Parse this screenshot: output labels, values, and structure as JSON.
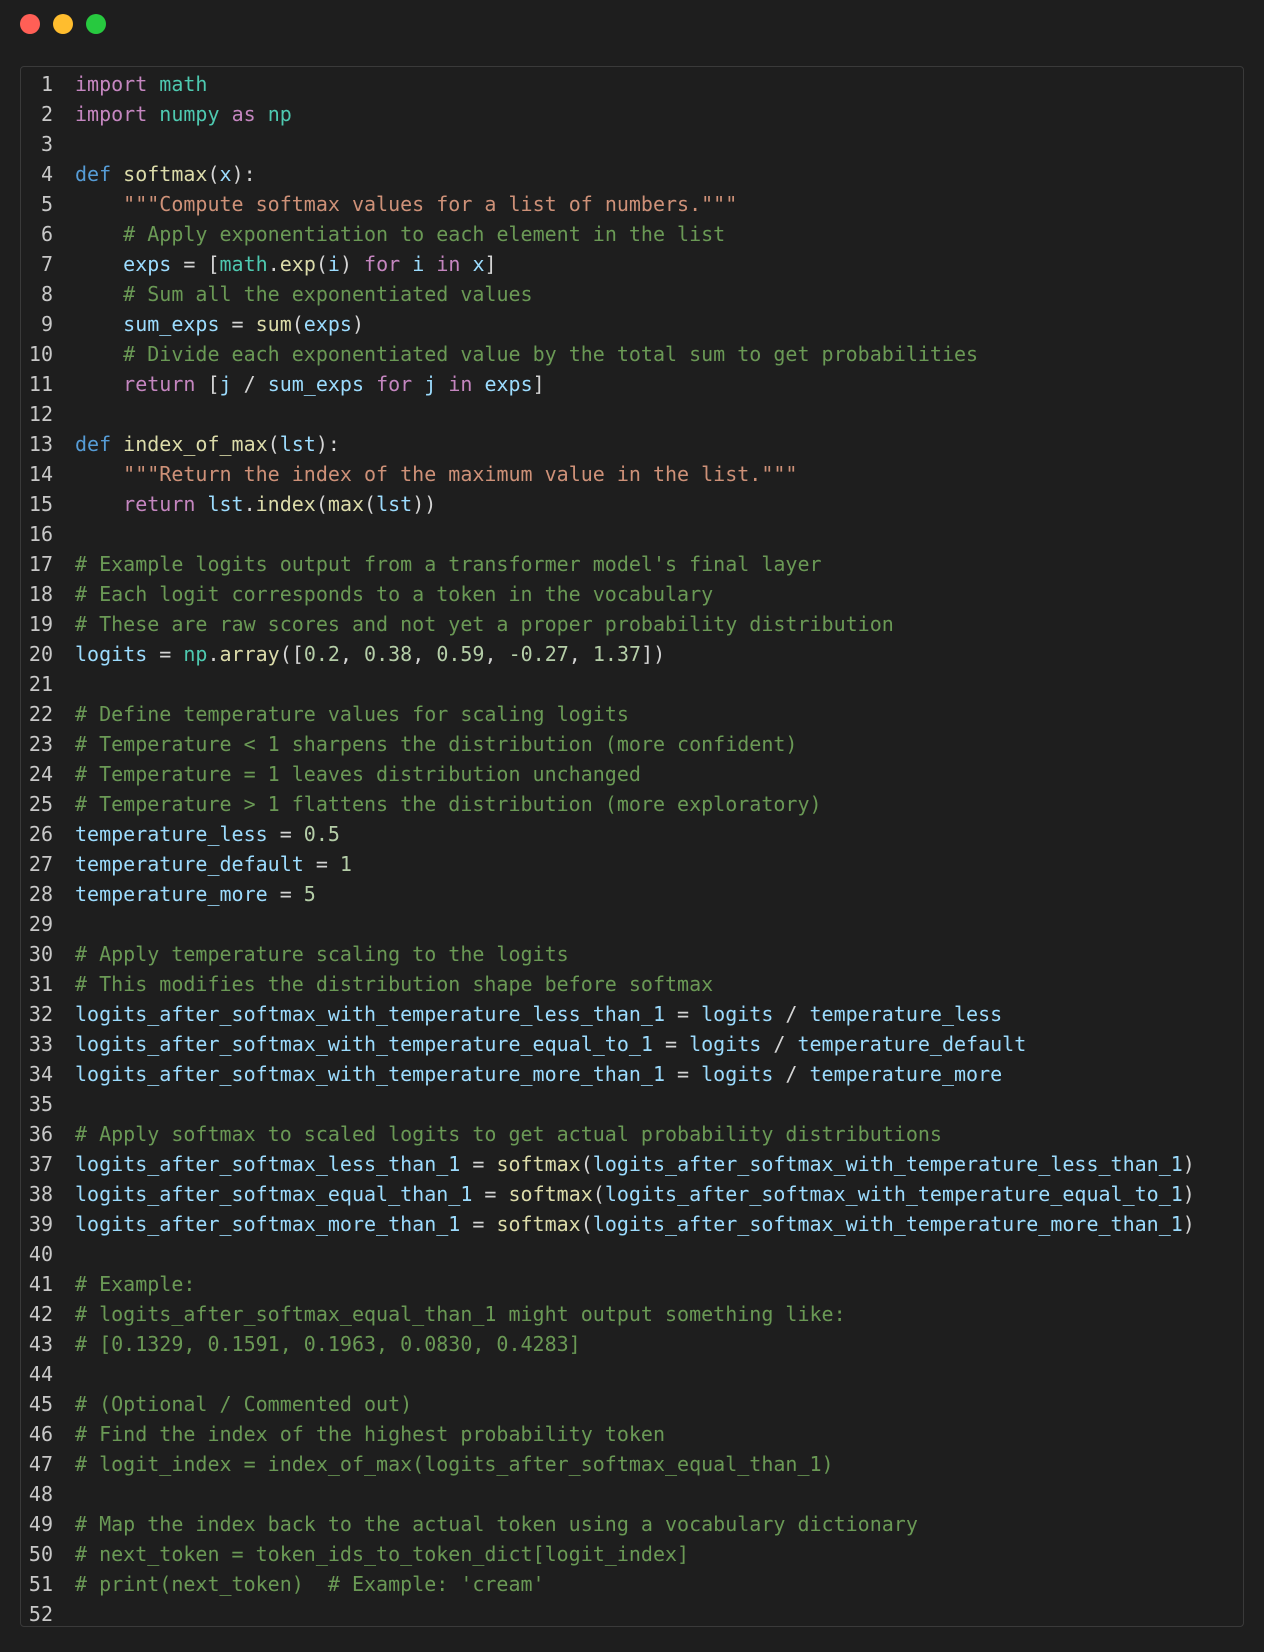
{
  "window": {
    "controls": [
      {
        "name": "close-button",
        "color": "#ff5f56"
      },
      {
        "name": "minimize-button",
        "color": "#ffbd2e"
      },
      {
        "name": "maximize-button",
        "color": "#27c93f"
      }
    ]
  },
  "theme": {
    "background": "#1e1e1e",
    "colors": {
      "plain": "#d4d4d4",
      "kw": "#c586c0",
      "def": "#569cd6",
      "mod": "#4ec9b0",
      "fn": "#dcdcaa",
      "var": "#9cdcfe",
      "str": "#ce9178",
      "cmt": "#6a9955",
      "num": "#b5cea8"
    }
  },
  "editor": {
    "lines": [
      {
        "n": "1",
        "tokens": [
          [
            "kw",
            "import"
          ],
          [
            "plain",
            " "
          ],
          [
            "mod",
            "math"
          ]
        ]
      },
      {
        "n": "2",
        "tokens": [
          [
            "kw",
            "import"
          ],
          [
            "plain",
            " "
          ],
          [
            "mod",
            "numpy"
          ],
          [
            "plain",
            " "
          ],
          [
            "kw",
            "as"
          ],
          [
            "plain",
            " "
          ],
          [
            "mod",
            "np"
          ]
        ]
      },
      {
        "n": "3",
        "tokens": []
      },
      {
        "n": "4",
        "tokens": [
          [
            "def",
            "def"
          ],
          [
            "plain",
            " "
          ],
          [
            "fn",
            "softmax"
          ],
          [
            "plain",
            "("
          ],
          [
            "var",
            "x"
          ],
          [
            "plain",
            "):"
          ]
        ]
      },
      {
        "n": "5",
        "tokens": [
          [
            "plain",
            "    "
          ],
          [
            "str",
            "\"\"\"Compute softmax values for a list of numbers.\"\"\""
          ]
        ]
      },
      {
        "n": "6",
        "tokens": [
          [
            "plain",
            "    "
          ],
          [
            "cmt",
            "# Apply exponentiation to each element in the list"
          ]
        ]
      },
      {
        "n": "7",
        "tokens": [
          [
            "plain",
            "    "
          ],
          [
            "var",
            "exps"
          ],
          [
            "plain",
            " = ["
          ],
          [
            "mod",
            "math"
          ],
          [
            "plain",
            "."
          ],
          [
            "fn",
            "exp"
          ],
          [
            "plain",
            "("
          ],
          [
            "var",
            "i"
          ],
          [
            "plain",
            ") "
          ],
          [
            "kw",
            "for"
          ],
          [
            "plain",
            " "
          ],
          [
            "var",
            "i"
          ],
          [
            "plain",
            " "
          ],
          [
            "kw",
            "in"
          ],
          [
            "plain",
            " "
          ],
          [
            "var",
            "x"
          ],
          [
            "plain",
            "]"
          ]
        ]
      },
      {
        "n": "8",
        "tokens": [
          [
            "plain",
            "    "
          ],
          [
            "cmt",
            "# Sum all the exponentiated values"
          ]
        ]
      },
      {
        "n": "9",
        "tokens": [
          [
            "plain",
            "    "
          ],
          [
            "var",
            "sum_exps"
          ],
          [
            "plain",
            " = "
          ],
          [
            "fn",
            "sum"
          ],
          [
            "plain",
            "("
          ],
          [
            "var",
            "exps"
          ],
          [
            "plain",
            ")"
          ]
        ]
      },
      {
        "n": "10",
        "tokens": [
          [
            "plain",
            "    "
          ],
          [
            "cmt",
            "# Divide each exponentiated value by the total sum to get probabilities"
          ]
        ]
      },
      {
        "n": "11",
        "tokens": [
          [
            "plain",
            "    "
          ],
          [
            "kw",
            "return"
          ],
          [
            "plain",
            " ["
          ],
          [
            "var",
            "j"
          ],
          [
            "plain",
            " / "
          ],
          [
            "var",
            "sum_exps"
          ],
          [
            "plain",
            " "
          ],
          [
            "kw",
            "for"
          ],
          [
            "plain",
            " "
          ],
          [
            "var",
            "j"
          ],
          [
            "plain",
            " "
          ],
          [
            "kw",
            "in"
          ],
          [
            "plain",
            " "
          ],
          [
            "var",
            "exps"
          ],
          [
            "plain",
            "]"
          ]
        ]
      },
      {
        "n": "12",
        "tokens": []
      },
      {
        "n": "13",
        "tokens": [
          [
            "def",
            "def"
          ],
          [
            "plain",
            " "
          ],
          [
            "fn",
            "index_of_max"
          ],
          [
            "plain",
            "("
          ],
          [
            "var",
            "lst"
          ],
          [
            "plain",
            "):"
          ]
        ]
      },
      {
        "n": "14",
        "tokens": [
          [
            "plain",
            "    "
          ],
          [
            "str",
            "\"\"\"Return the index of the maximum value in the list.\"\"\""
          ]
        ]
      },
      {
        "n": "15",
        "tokens": [
          [
            "plain",
            "    "
          ],
          [
            "kw",
            "return"
          ],
          [
            "plain",
            " "
          ],
          [
            "var",
            "lst"
          ],
          [
            "plain",
            "."
          ],
          [
            "fn",
            "index"
          ],
          [
            "plain",
            "("
          ],
          [
            "fn",
            "max"
          ],
          [
            "plain",
            "("
          ],
          [
            "var",
            "lst"
          ],
          [
            "plain",
            "))"
          ]
        ]
      },
      {
        "n": "16",
        "tokens": []
      },
      {
        "n": "17",
        "tokens": [
          [
            "cmt",
            "# Example logits output from a transformer model's final layer"
          ]
        ]
      },
      {
        "n": "18",
        "tokens": [
          [
            "cmt",
            "# Each logit corresponds to a token in the vocabulary"
          ]
        ]
      },
      {
        "n": "19",
        "tokens": [
          [
            "cmt",
            "# These are raw scores and not yet a proper probability distribution"
          ]
        ]
      },
      {
        "n": "20",
        "tokens": [
          [
            "var",
            "logits"
          ],
          [
            "plain",
            " = "
          ],
          [
            "mod",
            "np"
          ],
          [
            "plain",
            "."
          ],
          [
            "fn",
            "array"
          ],
          [
            "plain",
            "(["
          ],
          [
            "num",
            "0.2"
          ],
          [
            "plain",
            ", "
          ],
          [
            "num",
            "0.38"
          ],
          [
            "plain",
            ", "
          ],
          [
            "num",
            "0.59"
          ],
          [
            "plain",
            ", "
          ],
          [
            "num",
            "-0.27"
          ],
          [
            "plain",
            ", "
          ],
          [
            "num",
            "1.37"
          ],
          [
            "plain",
            "])"
          ]
        ]
      },
      {
        "n": "21",
        "tokens": []
      },
      {
        "n": "22",
        "tokens": [
          [
            "cmt",
            "# Define temperature values for scaling logits"
          ]
        ]
      },
      {
        "n": "23",
        "tokens": [
          [
            "cmt",
            "# Temperature < 1 sharpens the distribution (more confident)"
          ]
        ]
      },
      {
        "n": "24",
        "tokens": [
          [
            "cmt",
            "# Temperature = 1 leaves distribution unchanged"
          ]
        ]
      },
      {
        "n": "25",
        "tokens": [
          [
            "cmt",
            "# Temperature > 1 flattens the distribution (more exploratory)"
          ]
        ]
      },
      {
        "n": "26",
        "tokens": [
          [
            "var",
            "temperature_less"
          ],
          [
            "plain",
            " = "
          ],
          [
            "num",
            "0.5"
          ]
        ]
      },
      {
        "n": "27",
        "tokens": [
          [
            "var",
            "temperature_default"
          ],
          [
            "plain",
            " = "
          ],
          [
            "num",
            "1"
          ]
        ]
      },
      {
        "n": "28",
        "tokens": [
          [
            "var",
            "temperature_more"
          ],
          [
            "plain",
            " = "
          ],
          [
            "num",
            "5"
          ]
        ]
      },
      {
        "n": "29",
        "tokens": []
      },
      {
        "n": "30",
        "tokens": [
          [
            "cmt",
            "# Apply temperature scaling to the logits"
          ]
        ]
      },
      {
        "n": "31",
        "tokens": [
          [
            "cmt",
            "# This modifies the distribution shape before softmax"
          ]
        ]
      },
      {
        "n": "32",
        "tokens": [
          [
            "var",
            "logits_after_softmax_with_temperature_less_than_1"
          ],
          [
            "plain",
            " = "
          ],
          [
            "var",
            "logits"
          ],
          [
            "plain",
            " / "
          ],
          [
            "var",
            "temperature_less"
          ]
        ]
      },
      {
        "n": "33",
        "tokens": [
          [
            "var",
            "logits_after_softmax_with_temperature_equal_to_1"
          ],
          [
            "plain",
            " = "
          ],
          [
            "var",
            "logits"
          ],
          [
            "plain",
            " / "
          ],
          [
            "var",
            "temperature_default"
          ]
        ]
      },
      {
        "n": "34",
        "tokens": [
          [
            "var",
            "logits_after_softmax_with_temperature_more_than_1"
          ],
          [
            "plain",
            " = "
          ],
          [
            "var",
            "logits"
          ],
          [
            "plain",
            " / "
          ],
          [
            "var",
            "temperature_more"
          ]
        ]
      },
      {
        "n": "35",
        "tokens": []
      },
      {
        "n": "36",
        "tokens": [
          [
            "cmt",
            "# Apply softmax to scaled logits to get actual probability distributions"
          ]
        ]
      },
      {
        "n": "37",
        "tokens": [
          [
            "var",
            "logits_after_softmax_less_than_1"
          ],
          [
            "plain",
            " = "
          ],
          [
            "fn",
            "softmax"
          ],
          [
            "plain",
            "("
          ],
          [
            "var",
            "logits_after_softmax_with_temperature_less_than_1"
          ],
          [
            "plain",
            ")"
          ]
        ]
      },
      {
        "n": "38",
        "tokens": [
          [
            "var",
            "logits_after_softmax_equal_than_1"
          ],
          [
            "plain",
            " = "
          ],
          [
            "fn",
            "softmax"
          ],
          [
            "plain",
            "("
          ],
          [
            "var",
            "logits_after_softmax_with_temperature_equal_to_1"
          ],
          [
            "plain",
            ")"
          ]
        ]
      },
      {
        "n": "39",
        "tokens": [
          [
            "var",
            "logits_after_softmax_more_than_1"
          ],
          [
            "plain",
            " = "
          ],
          [
            "fn",
            "softmax"
          ],
          [
            "plain",
            "("
          ],
          [
            "var",
            "logits_after_softmax_with_temperature_more_than_1"
          ],
          [
            "plain",
            ")"
          ]
        ]
      },
      {
        "n": "40",
        "tokens": []
      },
      {
        "n": "41",
        "tokens": [
          [
            "cmt",
            "# Example:"
          ]
        ]
      },
      {
        "n": "42",
        "tokens": [
          [
            "cmt",
            "# logits_after_softmax_equal_than_1 might output something like:"
          ]
        ]
      },
      {
        "n": "43",
        "tokens": [
          [
            "cmt",
            "# [0.1329, 0.1591, 0.1963, 0.0830, 0.4283]"
          ]
        ]
      },
      {
        "n": "44",
        "tokens": []
      },
      {
        "n": "45",
        "tokens": [
          [
            "cmt",
            "# (Optional / Commented out)"
          ]
        ]
      },
      {
        "n": "46",
        "tokens": [
          [
            "cmt",
            "# Find the index of the highest probability token"
          ]
        ]
      },
      {
        "n": "47",
        "tokens": [
          [
            "cmt",
            "# logit_index = index_of_max(logits_after_softmax_equal_than_1)"
          ]
        ]
      },
      {
        "n": "48",
        "tokens": []
      },
      {
        "n": "49",
        "tokens": [
          [
            "cmt",
            "# Map the index back to the actual token using a vocabulary dictionary"
          ]
        ]
      },
      {
        "n": "50",
        "tokens": [
          [
            "cmt",
            "# next_token = token_ids_to_token_dict[logit_index]"
          ]
        ]
      },
      {
        "n": "51",
        "tokens": [
          [
            "cmt",
            "# print(next_token)  # Example: 'cream'"
          ]
        ]
      },
      {
        "n": "52",
        "tokens": []
      }
    ]
  }
}
